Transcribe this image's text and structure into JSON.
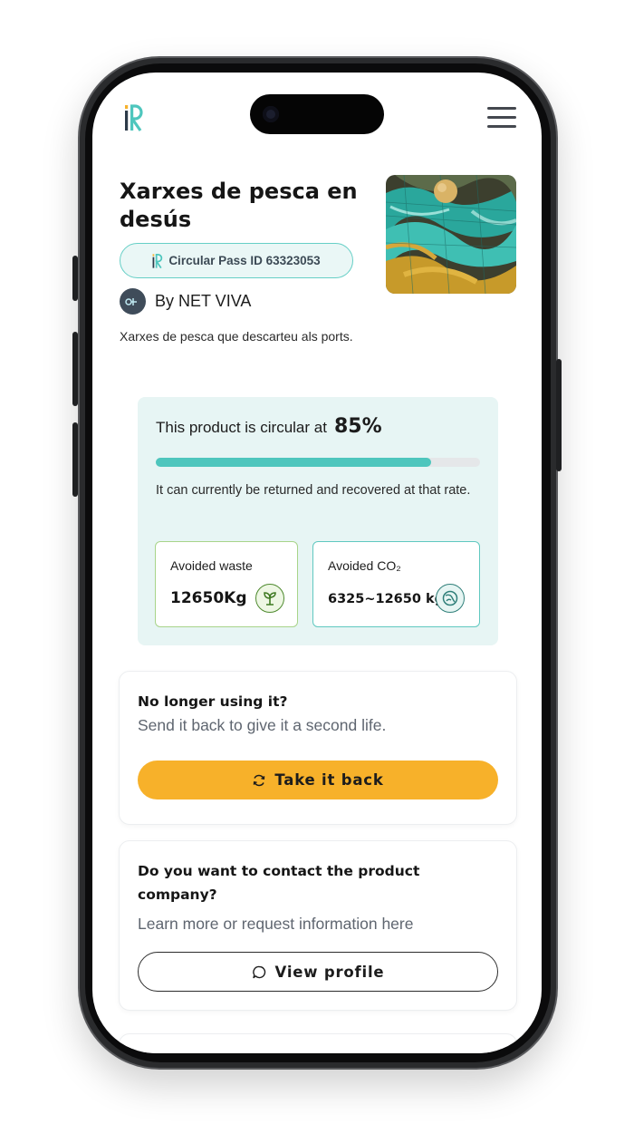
{
  "header": {
    "logo_icon": "circular-pass-logo-icon",
    "menu_icon": "hamburger-menu-icon"
  },
  "product": {
    "title": "Xarxes de pesca en desús",
    "pass_label": "Circular Pass ID 63323053",
    "author": "By NET VIVA",
    "description": "Xarxes de pesca que descarteu als ports.",
    "image_icon": "fishing-nets-photo"
  },
  "circularity": {
    "heading": "This product is circular at",
    "percent_label": "85%",
    "percent": 0.85,
    "note": "It can currently be returned and recovered at that rate.",
    "waste_label": "Avoided waste",
    "waste_value": "12650Kg",
    "co2_label": "Avoided CO₂",
    "co2_value": "6325~12650 kg"
  },
  "take_back": {
    "title": "No longer using it?",
    "subtitle": "Send it back to give it a second life.",
    "button_label": "Take it back"
  },
  "contact": {
    "title": "Do you want to contact the product company?",
    "subtitle": "Learn more or request information here",
    "button_label": "View profile"
  },
  "colors": {
    "accent_teal": "#4ec6bd",
    "button_yellow": "#f7b12a",
    "card_background": "#e7f5f4"
  }
}
